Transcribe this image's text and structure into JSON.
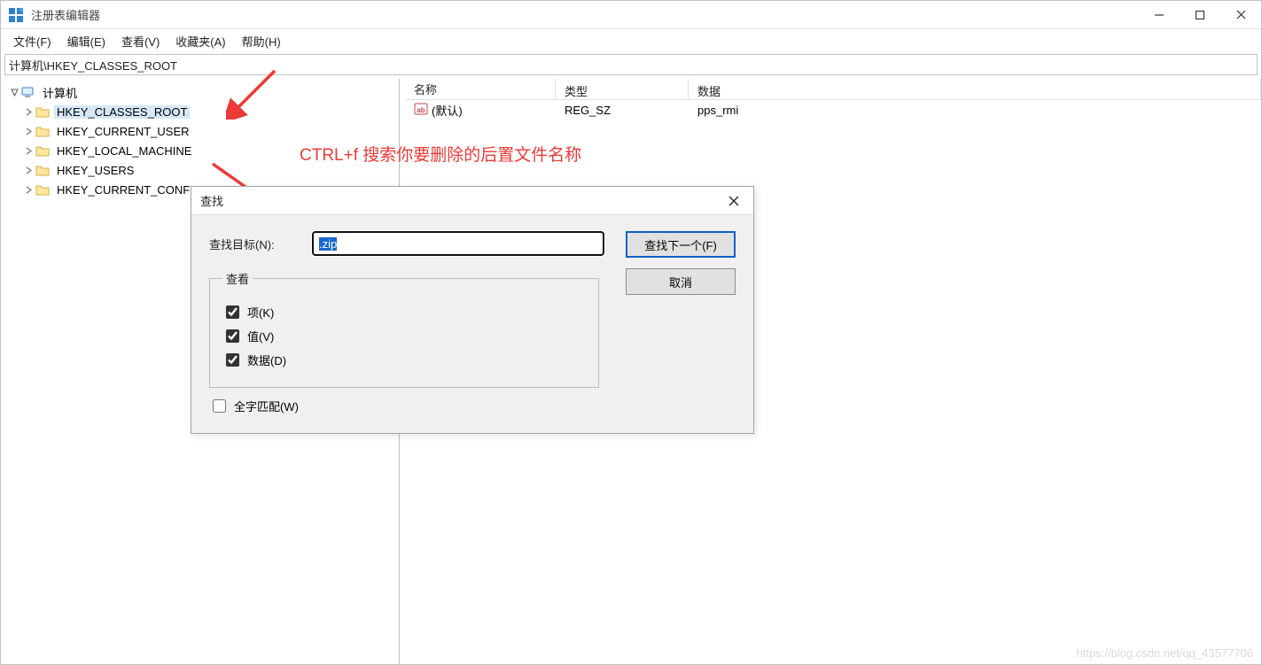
{
  "window": {
    "title": "注册表编辑器"
  },
  "menubar": {
    "file": "文件(F)",
    "edit": "编辑(E)",
    "view": "查看(V)",
    "favorites": "收藏夹(A)",
    "help": "帮助(H)"
  },
  "addressbar": {
    "path": "计算机\\HKEY_CLASSES_ROOT"
  },
  "tree": {
    "root": "计算机",
    "keys": [
      "HKEY_CLASSES_ROOT",
      "HKEY_CURRENT_USER",
      "HKEY_LOCAL_MACHINE",
      "HKEY_USERS",
      "HKEY_CURRENT_CONFIG"
    ],
    "selected_index": 0
  },
  "details": {
    "cols": {
      "name": "名称",
      "type": "类型",
      "data": "数据"
    },
    "rows": [
      {
        "name": "(默认)",
        "type": "REG_SZ",
        "data": "pps_rmi"
      }
    ]
  },
  "annotation": {
    "text": "CTRL+f 搜索你要删除的后置文件名称"
  },
  "find_dialog": {
    "title": "查找",
    "target_label": "查找目标(N):",
    "target_value": ".zip",
    "find_next": "查找下一个(F)",
    "cancel": "取消",
    "lookat_legend": "查看",
    "opt_keys": "项(K)",
    "opt_values": "值(V)",
    "opt_data": "数据(D)",
    "opt_wholeword": "全字匹配(W)"
  },
  "watermark": "https://blog.csdn.net/qq_43577706"
}
